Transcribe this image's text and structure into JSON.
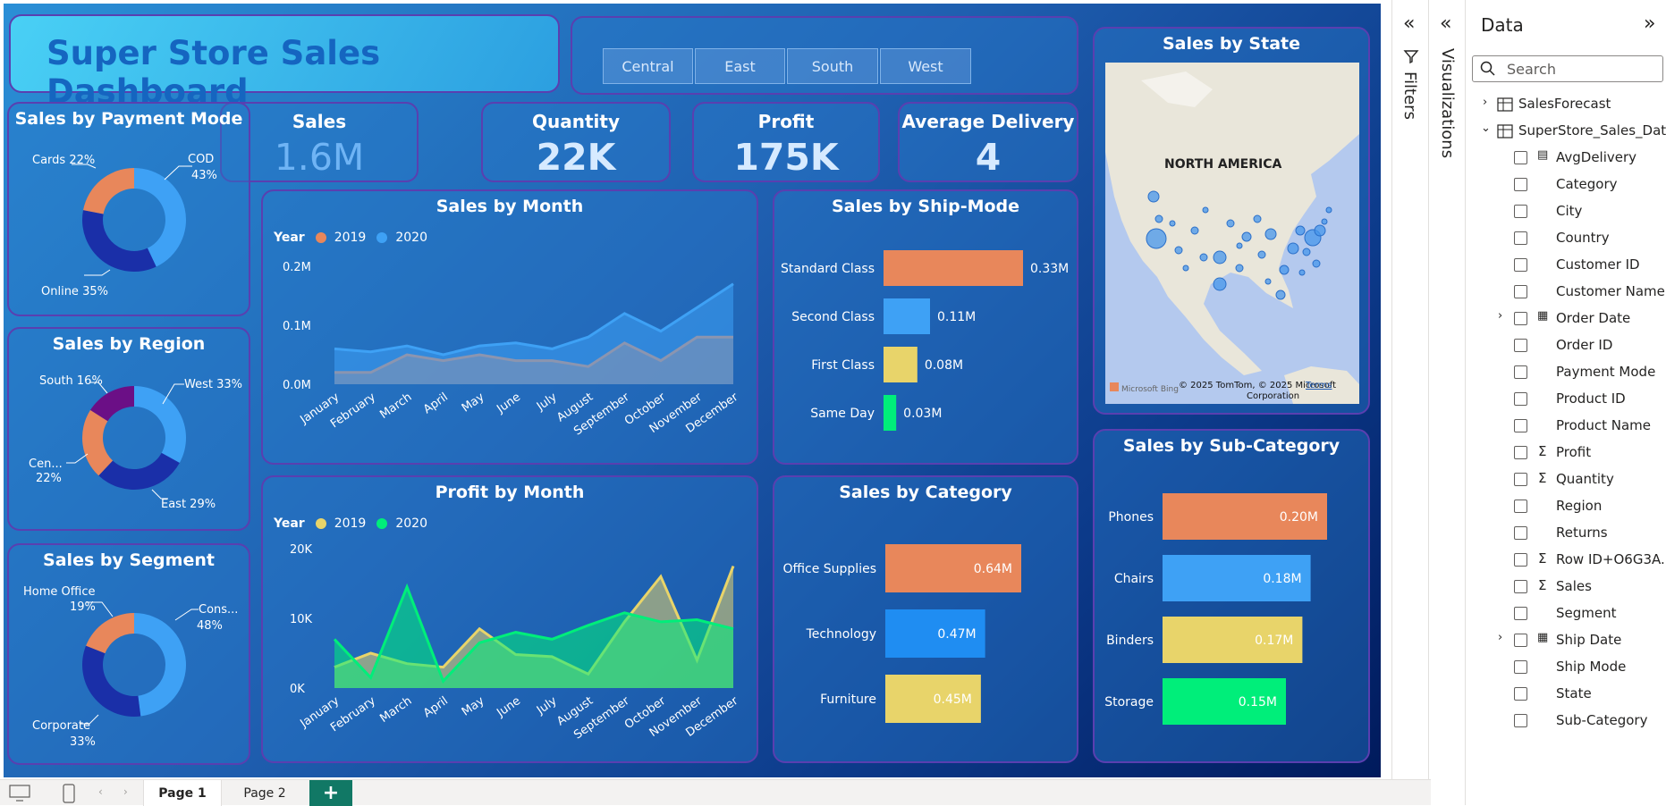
{
  "dashboard": {
    "title": "Super Store Sales Dashboard",
    "slicer": [
      "Central",
      "East",
      "South",
      "West"
    ],
    "kpis": [
      {
        "label": "Sales",
        "value": "1.6M"
      },
      {
        "label": "Quantity",
        "value": "22K"
      },
      {
        "label": "Profit",
        "value": "175K"
      },
      {
        "label": "Average Delivery",
        "value": "4"
      }
    ],
    "colors": {
      "orange": "#e8875b",
      "blue": "#3ea1f5",
      "yellow": "#e8d46a",
      "green": "#00ee7a",
      "darkblue": "#1a2fa8",
      "purple": "#6b0f86"
    }
  },
  "cards": {
    "payment": {
      "title": "Sales by Payment Mode",
      "labels": [
        "COD",
        "43%",
        "Online 35%",
        "Cards 22%"
      ]
    },
    "region": {
      "title": "Sales by Region",
      "labels": [
        "West 33%",
        "East 29%",
        "Cen...",
        "22%",
        "South 16%"
      ]
    },
    "segment": {
      "title": "Sales by Segment",
      "labels": [
        "Cons...",
        "48%",
        "Corporate",
        "33%",
        "Home Office",
        "19%"
      ]
    },
    "sales_month": {
      "title": "Sales by Month",
      "legend_title": "Year",
      "legend": [
        "2019",
        "2020"
      ]
    },
    "profit_month": {
      "title": "Profit by Month",
      "legend_title": "Year",
      "legend": [
        "2019",
        "2020"
      ]
    },
    "ship_mode": {
      "title": "Sales by Ship-Mode"
    },
    "category": {
      "title": "Sales by Category"
    },
    "state": {
      "title": "Sales by State",
      "map_label": "NORTH AMERICA",
      "attribution": "© 2025 TomTom, © 2025 Microsoft",
      "attribution2": "Corporation",
      "terms": "Terms",
      "bing": "Microsoft Bing"
    },
    "subcat": {
      "title": "Sales by Sub-Category"
    }
  },
  "chart_data": [
    {
      "type": "pie",
      "title": "Sales by Payment Mode",
      "categories": [
        "COD",
        "Online",
        "Cards"
      ],
      "values": [
        43,
        35,
        22
      ],
      "colors": [
        "#3ea1f5",
        "#1a2fa8",
        "#e8875b"
      ]
    },
    {
      "type": "pie",
      "title": "Sales by Region",
      "categories": [
        "West",
        "East",
        "Central",
        "South"
      ],
      "values": [
        33,
        29,
        22,
        16
      ],
      "colors": [
        "#3ea1f5",
        "#1a2fa8",
        "#e8875b",
        "#6b0f86"
      ]
    },
    {
      "type": "pie",
      "title": "Sales by Segment",
      "categories": [
        "Consumer",
        "Corporate",
        "Home Office"
      ],
      "values": [
        48,
        33,
        19
      ],
      "colors": [
        "#3ea1f5",
        "#1a2fa8",
        "#e8875b"
      ]
    },
    {
      "type": "area",
      "title": "Sales by Month",
      "categories": [
        "January",
        "February",
        "March",
        "April",
        "May",
        "June",
        "July",
        "August",
        "September",
        "October",
        "November",
        "December"
      ],
      "series": [
        {
          "name": "2019",
          "color": "#e8875b",
          "values": [
            0.02,
            0.02,
            0.05,
            0.04,
            0.05,
            0.04,
            0.04,
            0.03,
            0.07,
            0.04,
            0.08,
            0.08
          ]
        },
        {
          "name": "2020",
          "color": "#3ea1f5",
          "values": [
            0.06,
            0.055,
            0.065,
            0.05,
            0.065,
            0.07,
            0.06,
            0.08,
            0.12,
            0.09,
            0.13,
            0.17
          ]
        }
      ],
      "yticks": [
        "0.0M",
        "0.1M",
        "0.2M"
      ],
      "ylim": [
        0,
        0.2
      ]
    },
    {
      "type": "area",
      "title": "Profit by Month",
      "categories": [
        "January",
        "February",
        "March",
        "April",
        "May",
        "June",
        "July",
        "August",
        "September",
        "October",
        "November",
        "December"
      ],
      "series": [
        {
          "name": "2019",
          "color": "#e8d46a",
          "values": [
            3000,
            5000,
            3500,
            3000,
            8500,
            4800,
            4500,
            2000,
            9500,
            16000,
            4000,
            17500
          ]
        },
        {
          "name": "2020",
          "color": "#00ee7a",
          "values": [
            7000,
            1500,
            14500,
            1000,
            6500,
            8000,
            7000,
            9000,
            10800,
            9500,
            9800,
            8500
          ]
        }
      ],
      "yticks": [
        "0K",
        "10K",
        "20K"
      ],
      "ylim": [
        0,
        20000
      ]
    },
    {
      "type": "bar",
      "title": "Sales by Ship-Mode",
      "categories": [
        "Standard Class",
        "Second Class",
        "First Class",
        "Same Day"
      ],
      "values": [
        0.33,
        0.11,
        0.08,
        0.03
      ],
      "labels": [
        "0.33M",
        "0.11M",
        "0.08M",
        "0.03M"
      ],
      "colors": [
        "#e8875b",
        "#3ea1f5",
        "#e8d46a",
        "#00ee7a"
      ]
    },
    {
      "type": "bar",
      "title": "Sales by Category",
      "categories": [
        "Office Supplies",
        "Technology",
        "Furniture"
      ],
      "values": [
        0.64,
        0.47,
        0.45
      ],
      "labels": [
        "0.64M",
        "0.47M",
        "0.45M"
      ],
      "colors": [
        "#e8875b",
        "#1f8df2",
        "#e8d46a"
      ]
    },
    {
      "type": "bar",
      "title": "Sales by Sub-Category",
      "categories": [
        "Phones",
        "Chairs",
        "Binders",
        "Storage"
      ],
      "values": [
        0.2,
        0.18,
        0.17,
        0.15
      ],
      "labels": [
        "0.20M",
        "0.18M",
        "0.17M",
        "0.15M"
      ],
      "colors": [
        "#e8875b",
        "#3ea1f5",
        "#e8d46a",
        "#00ee7a"
      ]
    }
  ],
  "panes": {
    "filters": "Filters",
    "visualizations": "Visualizations",
    "data_title": "Data",
    "search_placeholder": "Search",
    "tables": [
      "SalesForecast",
      "SuperStore_Sales_Dat..."
    ],
    "fields": [
      {
        "name": "AvgDelivery",
        "kind": "calc"
      },
      {
        "name": "Category",
        "kind": ""
      },
      {
        "name": "City",
        "kind": ""
      },
      {
        "name": "Country",
        "kind": ""
      },
      {
        "name": "Customer ID",
        "kind": ""
      },
      {
        "name": "Customer Name",
        "kind": ""
      },
      {
        "name": "Order Date",
        "kind": "date"
      },
      {
        "name": "Order ID",
        "kind": ""
      },
      {
        "name": "Payment Mode",
        "kind": ""
      },
      {
        "name": "Product ID",
        "kind": ""
      },
      {
        "name": "Product Name",
        "kind": ""
      },
      {
        "name": "Profit",
        "kind": "sum"
      },
      {
        "name": "Quantity",
        "kind": "sum"
      },
      {
        "name": "Region",
        "kind": ""
      },
      {
        "name": "Returns",
        "kind": ""
      },
      {
        "name": "Row ID+O6G3A...",
        "kind": "sum"
      },
      {
        "name": "Sales",
        "kind": "sum"
      },
      {
        "name": "Segment",
        "kind": ""
      },
      {
        "name": "Ship Date",
        "kind": "date"
      },
      {
        "name": "Ship Mode",
        "kind": ""
      },
      {
        "name": "State",
        "kind": ""
      },
      {
        "name": "Sub-Category",
        "kind": ""
      }
    ]
  },
  "pages": [
    "Page 1",
    "Page 2"
  ],
  "add_page": "+"
}
